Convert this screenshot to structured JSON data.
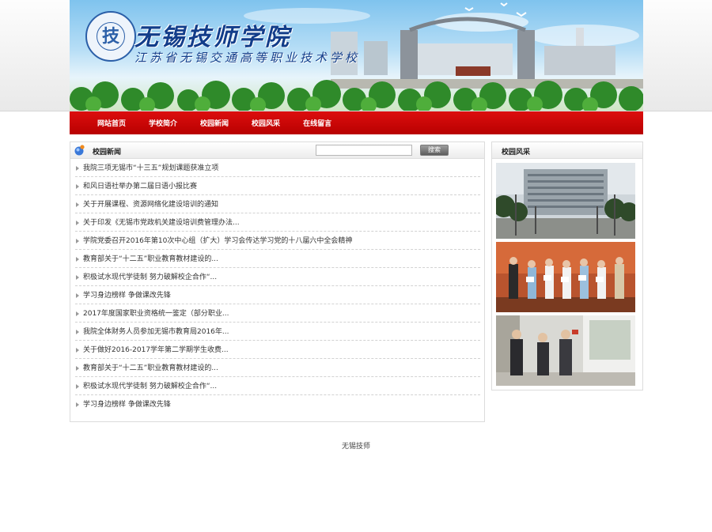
{
  "header": {
    "school_name": "无锡技师学院",
    "school_subtitle": "江苏省无锡交通高等职业技术学校",
    "seal_char": "技"
  },
  "nav": {
    "items": [
      {
        "label": "网站首页"
      },
      {
        "label": "学校简介"
      },
      {
        "label": "校园新闻"
      },
      {
        "label": "校园风采"
      },
      {
        "label": "在线留言"
      }
    ]
  },
  "news": {
    "title": "校园新闻",
    "search_placeholder": "",
    "search_button": "搜索",
    "items": [
      {
        "title": "我院三项无锡市“十三五”规划课题获准立项"
      },
      {
        "title": "和风日语社举办第二届日语小报比赛"
      },
      {
        "title": "关于开展课程、资源网络化建设培训的通知"
      },
      {
        "title": "关于印发《无锡市党政机关建设培训费管理办法..."
      },
      {
        "title": "学院党委召开2016年第10次中心组（扩大）学习会传达学习党的十八届六中全会精神"
      },
      {
        "title": "教育部关于“十二五”职业教育教材建设的..."
      },
      {
        "title": "积极试水现代学徒制 努力破解校企合作“..."
      },
      {
        "title": "学习身边榜样 争做课改先锋"
      },
      {
        "title": "2017年度国家职业资格统一鉴定（部分职业..."
      },
      {
        "title": "我院全体财务人员参加无锡市教育局2016年..."
      },
      {
        "title": "关于做好2016-2017学年第二学期学生收费..."
      },
      {
        "title": "教育部关于“十二五”职业教育教材建设的..."
      },
      {
        "title": "积极试水现代学徒制 努力破解校企合作“..."
      },
      {
        "title": "学习身边榜样 争做课改先锋"
      }
    ]
  },
  "campus": {
    "title": "校园风采"
  },
  "footer": {
    "text": "无锡技师"
  },
  "colors": {
    "nav_red": "#c80000",
    "title_blue": "#123d8a"
  }
}
